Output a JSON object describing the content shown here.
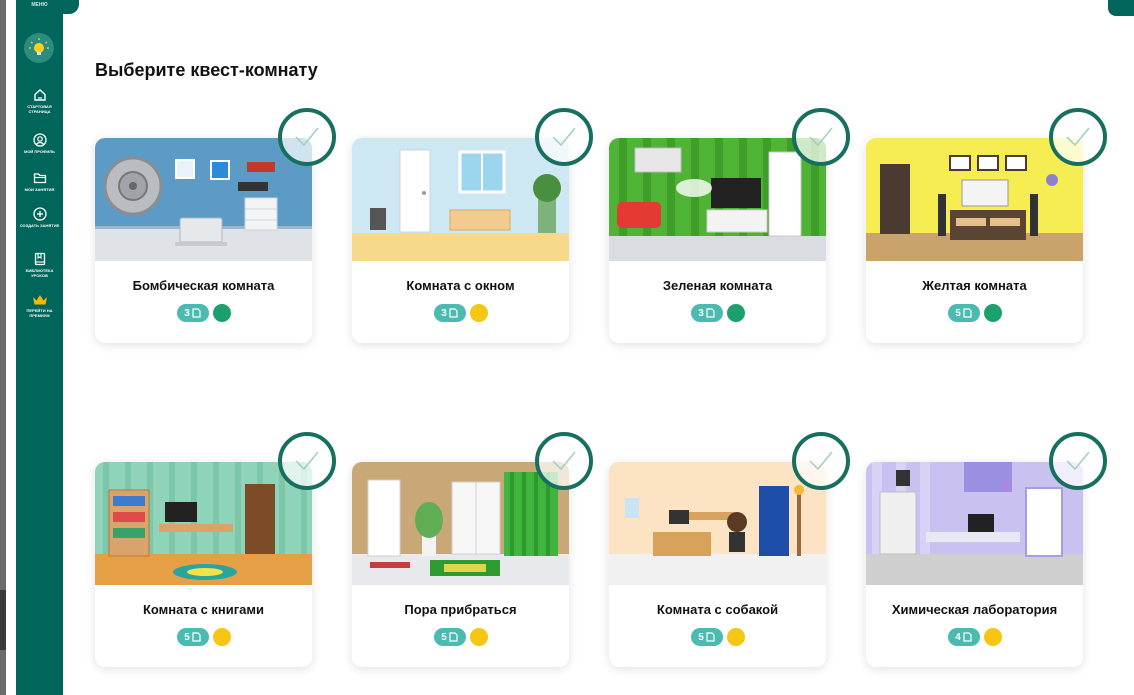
{
  "sidebar": {
    "menu_label": "МЕНЮ",
    "items": [
      {
        "label": "СТАРТОВАЯ СТРАНИЦА",
        "icon": "home-icon"
      },
      {
        "label": "МОЙ ПРОФИЛЬ",
        "icon": "profile-icon"
      },
      {
        "label": "МОИ ЗАНЯТИЯ",
        "icon": "folder-icon"
      },
      {
        "label": "СОЗДАТЬ ЗАНЯТИЕ",
        "icon": "plus-circle-icon"
      },
      {
        "label": "БИБЛИОТЕКА УРОКОВ",
        "icon": "book-icon"
      },
      {
        "label": "ПЕРЕЙТИ НА ПРЕМИУМ",
        "icon": "crown-icon"
      }
    ]
  },
  "main": {
    "title": "Выберите квест-комнату"
  },
  "colors": {
    "brand": "#00655a",
    "badge": "#4bbab0",
    "green_dot": "#1ca06e",
    "yellow_dot": "#f6c615"
  },
  "rooms": [
    {
      "title": "Бомбическая комната",
      "count": "3",
      "difficulty": "green"
    },
    {
      "title": "Комната с окном",
      "count": "3",
      "difficulty": "yellow"
    },
    {
      "title": "Зеленая комната",
      "count": "3",
      "difficulty": "green"
    },
    {
      "title": "Желтая комната",
      "count": "5",
      "difficulty": "green"
    },
    {
      "title": "Комната с книгами",
      "count": "5",
      "difficulty": "yellow"
    },
    {
      "title": "Пора прибраться",
      "count": "5",
      "difficulty": "yellow"
    },
    {
      "title": "Комната с собакой",
      "count": "5",
      "difficulty": "yellow"
    },
    {
      "title": "Химическая лаборатория",
      "count": "4",
      "difficulty": "yellow"
    }
  ]
}
